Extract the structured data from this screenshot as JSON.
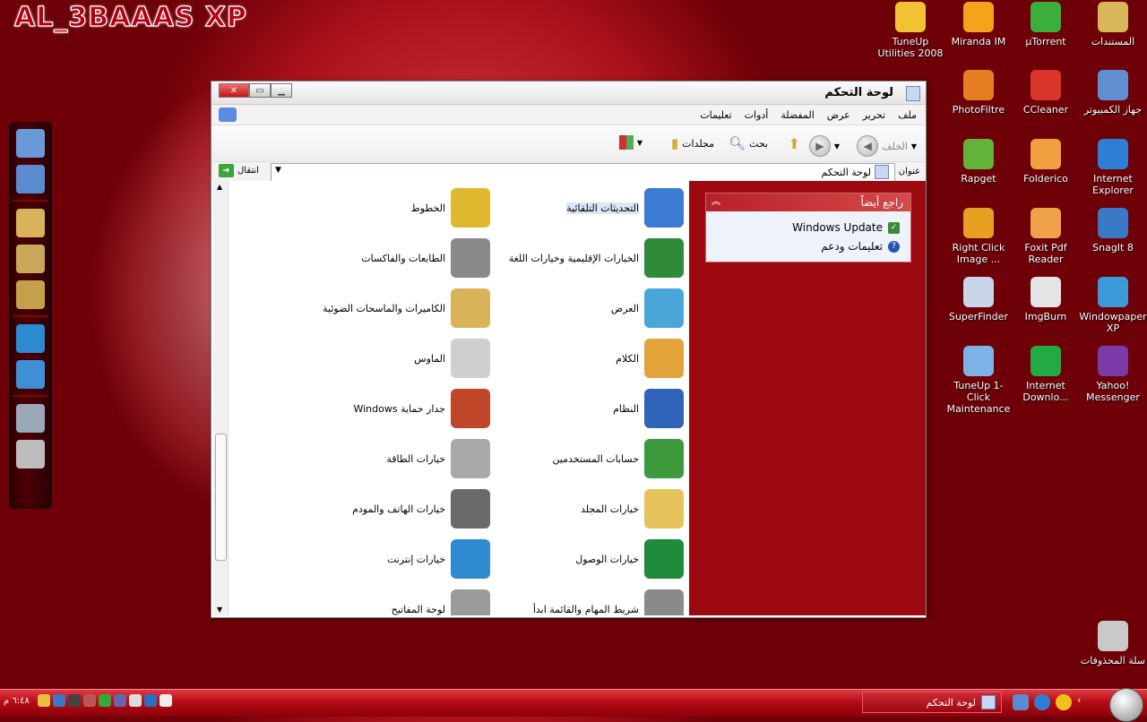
{
  "watermark": "AL_3BAAAS XP",
  "desktop_icons": [
    {
      "label": "TuneUp Utilities 2008",
      "icon": "tuneup-utilities-icon",
      "color": "#f1c232"
    },
    {
      "label": "Miranda IM",
      "icon": "miranda-im-icon",
      "color": "#f7a21b"
    },
    {
      "label": "µTorrent",
      "icon": "utorrent-icon",
      "color": "#3cae3c"
    },
    {
      "label": "المستندات",
      "icon": "documents-folder-icon",
      "color": "#d8b65a"
    },
    {
      "label": "PhotoFiltre",
      "icon": "photofiltre-icon",
      "color": "#e67e22"
    },
    {
      "label": "CCleaner",
      "icon": "ccleaner-icon",
      "color": "#d9352b"
    },
    {
      "label": "جهاز الكمبيوتر",
      "icon": "my-computer-icon",
      "color": "#5f8fd1"
    },
    {
      "label": "Rapget",
      "icon": "rapget-icon",
      "color": "#63b23a"
    },
    {
      "label": "Folderico",
      "icon": "folderico-icon",
      "color": "#f0a040"
    },
    {
      "label": "Internet Explorer",
      "icon": "internet-explorer-icon",
      "color": "#2e7fd4"
    },
    {
      "label": "Right Click Image ...",
      "icon": "right-click-image-icon",
      "color": "#e8a020"
    },
    {
      "label": "Foxit Pdf Reader",
      "icon": "foxit-reader-icon",
      "color": "#f0a24a"
    },
    {
      "label": "SnagIt 8",
      "icon": "snagit-icon",
      "color": "#3a79c6"
    },
    {
      "label": "SuperFinder",
      "icon": "superfinder-icon",
      "color": "#c9d6ea"
    },
    {
      "label": "ImgBurn",
      "icon": "imgburn-icon",
      "color": "#e4e4e4"
    },
    {
      "label": "Windowpaper XP",
      "icon": "windowpaper-icon",
      "color": "#3c9ad8"
    },
    {
      "label": "TuneUp 1-Click Maintenance",
      "icon": "tuneup-1click-icon",
      "color": "#7eb1e6"
    },
    {
      "label": "Internet Downlo...",
      "icon": "internet-download-manager-icon",
      "color": "#22aa44"
    },
    {
      "label": "Yahoo! Messenger",
      "icon": "yahoo-messenger-icon",
      "color": "#7b3aa8"
    },
    {
      "label": "سلة المحذوفات",
      "icon": "recycle-bin-icon",
      "color": "#c9c9c9"
    }
  ],
  "dock_icons": [
    "my-computer-icon",
    "desktop-icon",
    "library-icon",
    "documents-icon",
    "pictures-icon",
    "globe-icon",
    "media-player-icon",
    "settings-gear-icon",
    "recycle-bin-icon"
  ],
  "window": {
    "title": "لوحة التحكم",
    "menu": [
      "ملف",
      "تحرير",
      "عرض",
      "المفضلة",
      "أدوات",
      "تعليمات"
    ],
    "toolbar": {
      "back": "الخلف",
      "search": "بحث",
      "folders": "مجلدات"
    },
    "address": {
      "label": "عنوان",
      "value": "لوحة التحكم",
      "go": "انتقال"
    },
    "see_also": {
      "title": "راجع أيضاً",
      "links": [
        "Windows Update",
        "تعليمات ودعم"
      ]
    },
    "items": [
      {
        "label": "التحديثات التلقائية",
        "icon": "automatic-updates-icon",
        "color": "#3b7bd4"
      },
      {
        "label": "الخطوط",
        "icon": "fonts-folder-icon",
        "color": "#e0b830"
      },
      {
        "label": "الخيارات الإقليمية وخيارات اللغة",
        "icon": "regional-language-icon",
        "color": "#2f8a3a"
      },
      {
        "label": "الطابعات والفاكسات",
        "icon": "printers-faxes-icon",
        "color": "#8a8a8a"
      },
      {
        "label": "العرض",
        "icon": "display-icon",
        "color": "#4aa6d9"
      },
      {
        "label": "الكاميرات والماسحات الضوئية",
        "icon": "scanners-cameras-icon",
        "color": "#d8b35a"
      },
      {
        "label": "الكلام",
        "icon": "speech-icon",
        "color": "#e2a33a"
      },
      {
        "label": "الماوس",
        "icon": "mouse-icon",
        "color": "#cfcfcf"
      },
      {
        "label": "النظام",
        "icon": "system-icon",
        "color": "#2f64b8"
      },
      {
        "label": "Windows جدار حماية",
        "icon": "firewall-icon",
        "color": "#c0462a"
      },
      {
        "label": "حسابات المستخدمين",
        "icon": "user-accounts-icon",
        "color": "#3c9a3c"
      },
      {
        "label": "خيارات الطاقة",
        "icon": "power-options-icon",
        "color": "#a9a9a9"
      },
      {
        "label": "خيارات المجلد",
        "icon": "folder-options-icon",
        "color": "#e6c25a"
      },
      {
        "label": "خيارات الهاتف والمودم",
        "icon": "phone-modem-icon",
        "color": "#6a6a6a"
      },
      {
        "label": "خيارات الوصول",
        "icon": "accessibility-icon",
        "color": "#1e8b3a"
      },
      {
        "label": "خيارات إنترنت",
        "icon": "internet-options-icon",
        "color": "#2f8ad0"
      },
      {
        "label": "شريط المهام والقائمة ابدأ",
        "icon": "taskbar-start-menu-icon",
        "color": "#8a8a8a"
      },
      {
        "label": "لوحة المفاتيح",
        "icon": "keyboard-icon",
        "color": "#9a9a9a"
      }
    ]
  },
  "taskbar": {
    "task": "لوحة التحكم",
    "clock": "٦:٤٨ م"
  },
  "colors": {
    "accent": "#b40d16",
    "side_panel": "#9c0a10"
  }
}
